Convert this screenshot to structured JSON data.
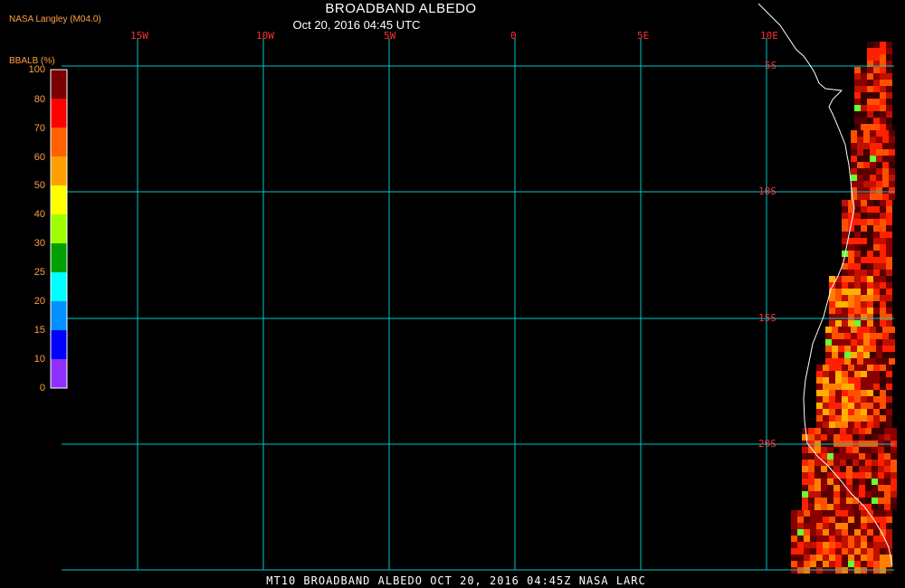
{
  "header": {
    "producer": "NASA Langley (M04.0)",
    "title": "BROADBAND ALBEDO",
    "subtitle": "Oct 20, 2016 04:45 UTC"
  },
  "footer": {
    "caption": "MT10  BROADBAND ALBEDO  OCT 20, 2016 04:45Z  NASA LARC"
  },
  "map": {
    "lon_labels": [
      "15W",
      "10W",
      "5W",
      "0",
      "5E",
      "10E"
    ],
    "lat_labels": [
      "5S",
      "10S",
      "15S",
      "20S"
    ],
    "grid_color": "#00c8c8",
    "label_color": "#ff3030",
    "coast_color": "#ffffff"
  },
  "colorbar": {
    "title": "BBALB (%)",
    "labels": [
      "100",
      "80",
      "70",
      "60",
      "50",
      "40",
      "30",
      "25",
      "20",
      "15",
      "10",
      "0"
    ],
    "colors": [
      "#7a0000",
      "#ff0000",
      "#ff6000",
      "#ffa000",
      "#ffff00",
      "#a0ff00",
      "#00a000",
      "#00ffff",
      "#0090ff",
      "#0000ff",
      "#9030ff"
    ]
  }
}
